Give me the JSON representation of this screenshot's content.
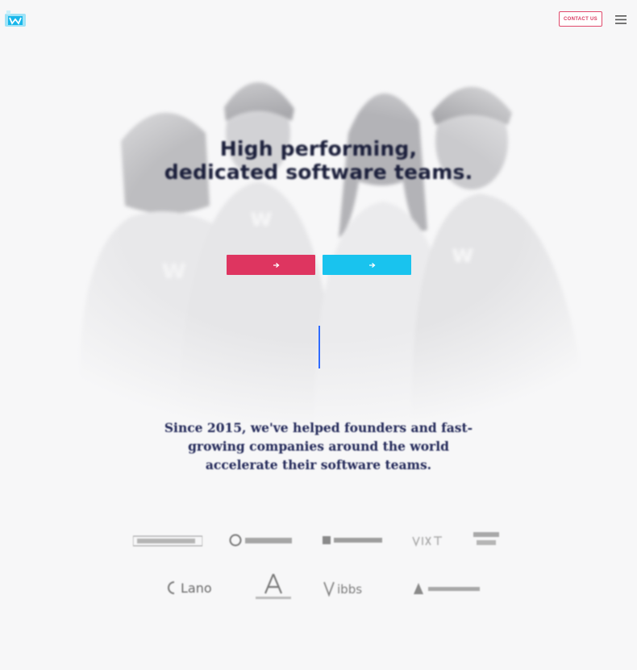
{
  "header": {
    "logo_icon": "w-logo-icon",
    "logo_text": "",
    "contact_label": "CONTACT US",
    "menu_icon": "hamburger-menu-icon",
    "accent_color": "#de3560"
  },
  "hero": {
    "headline_line1": "High performing,",
    "headline_line2": "dedicated software teams.",
    "subtext_line1": "",
    "subtext_line2": "",
    "primary_button_label": "",
    "secondary_button_label": "",
    "primary_color": "#de3560",
    "secondary_color": "#19c3ee"
  },
  "since": {
    "line1": "Since 2015, we've helped founders and fast-",
    "line2": "growing companies around the world",
    "line3": "accelerate their software teams."
  },
  "clients": {
    "row1": [
      "",
      "",
      "",
      "",
      ""
    ],
    "row2": [
      "",
      "",
      "",
      ""
    ]
  }
}
